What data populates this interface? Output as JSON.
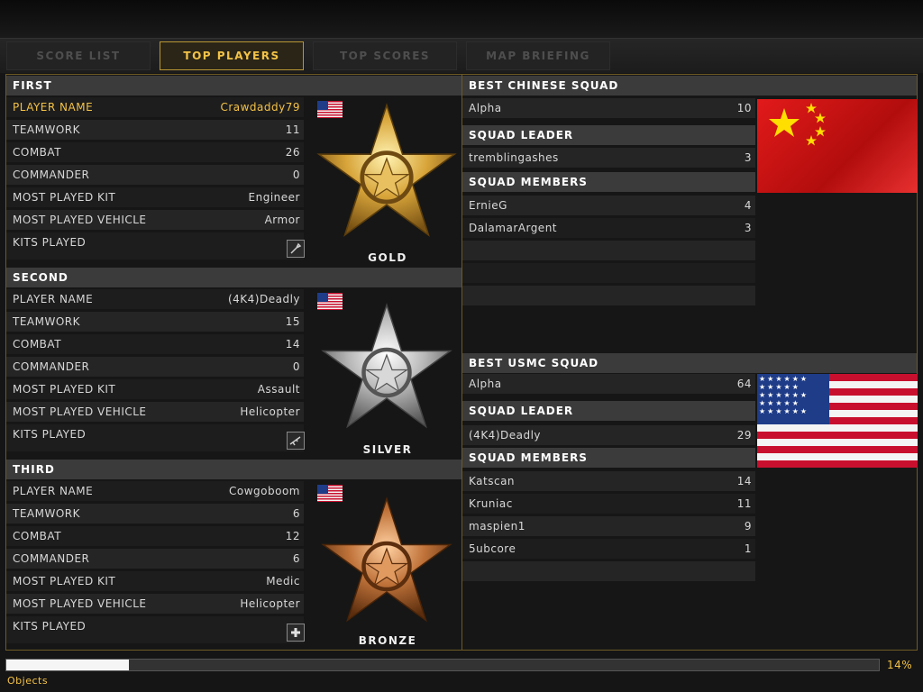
{
  "tabs": [
    {
      "label": "SCORE LIST"
    },
    {
      "label": "TOP PLAYERS"
    },
    {
      "label": "TOP SCORES"
    },
    {
      "label": "MAP BRIEFING"
    }
  ],
  "active_tab": "TOP PLAYERS",
  "players": [
    {
      "rank": "FIRST",
      "player_name_label": "PLAYER NAME",
      "player_name": "Crawdaddy79",
      "teamwork_label": "TEAMWORK",
      "teamwork": "11",
      "combat_label": "COMBAT",
      "combat": "26",
      "commander_label": "COMMANDER",
      "commander": "0",
      "kit_label": "MOST PLAYED KIT",
      "kit": "Engineer",
      "vehicle_label": "MOST PLAYED VEHICLE",
      "vehicle": "Armor",
      "kits_played_label": "KITS PLAYED",
      "kit_icon": "wrench-icon",
      "medal": "GOLD",
      "flag": "us-flag-icon"
    },
    {
      "rank": "SECOND",
      "player_name_label": "PLAYER NAME",
      "player_name": "(4K4)Deadly",
      "teamwork_label": "TEAMWORK",
      "teamwork": "15",
      "combat_label": "COMBAT",
      "combat": "14",
      "commander_label": "COMMANDER",
      "commander": "0",
      "kit_label": "MOST PLAYED KIT",
      "kit": "Assault",
      "vehicle_label": "MOST PLAYED VEHICLE",
      "vehicle": "Helicopter",
      "kits_played_label": "KITS PLAYED",
      "kit_icon": "rifle-icon",
      "medal": "SILVER",
      "flag": "us-flag-icon"
    },
    {
      "rank": "THIRD",
      "player_name_label": "PLAYER NAME",
      "player_name": "Cowgoboom",
      "teamwork_label": "TEAMWORK",
      "teamwork": "6",
      "combat_label": "COMBAT",
      "combat": "12",
      "commander_label": "COMMANDER",
      "commander": "6",
      "kit_label": "MOST PLAYED KIT",
      "kit": "Medic",
      "vehicle_label": "MOST PLAYED VEHICLE",
      "vehicle": "Helicopter",
      "kits_played_label": "KITS PLAYED",
      "kit_icon": "medic-cross-icon",
      "medal": "BRONZE",
      "flag": "us-flag-icon"
    }
  ],
  "chinese_squad": {
    "title": "BEST CHINESE SQUAD",
    "squad_name": "Alpha",
    "squad_score": "10",
    "leader_label": "SQUAD LEADER",
    "leader": {
      "name": "tremblingashes",
      "score": "3"
    },
    "members_label": "SQUAD MEMBERS",
    "members": [
      {
        "name": "ErnieG",
        "score": "4"
      },
      {
        "name": "DalamarArgent",
        "score": "3"
      }
    ],
    "flag": "china-flag"
  },
  "usmc_squad": {
    "title": "BEST USMC SQUAD",
    "squad_name": "Alpha",
    "squad_score": "64",
    "leader_label": "SQUAD LEADER",
    "leader": {
      "name": "(4K4)Deadly",
      "score": "29"
    },
    "members_label": "SQUAD MEMBERS",
    "members": [
      {
        "name": "Katscan",
        "score": "14"
      },
      {
        "name": "Kruniac",
        "score": "11"
      },
      {
        "name": "maspien1",
        "score": "9"
      },
      {
        "name": "5ubcore",
        "score": "1"
      }
    ],
    "flag": "usa-flag"
  },
  "loading": {
    "percent_text": "14%",
    "percent": 14,
    "status": "Objects"
  },
  "colors": {
    "accent": "#f3c247",
    "gold": "#d8a53a",
    "silver": "#c8c8c8",
    "bronze": "#c0733a"
  }
}
